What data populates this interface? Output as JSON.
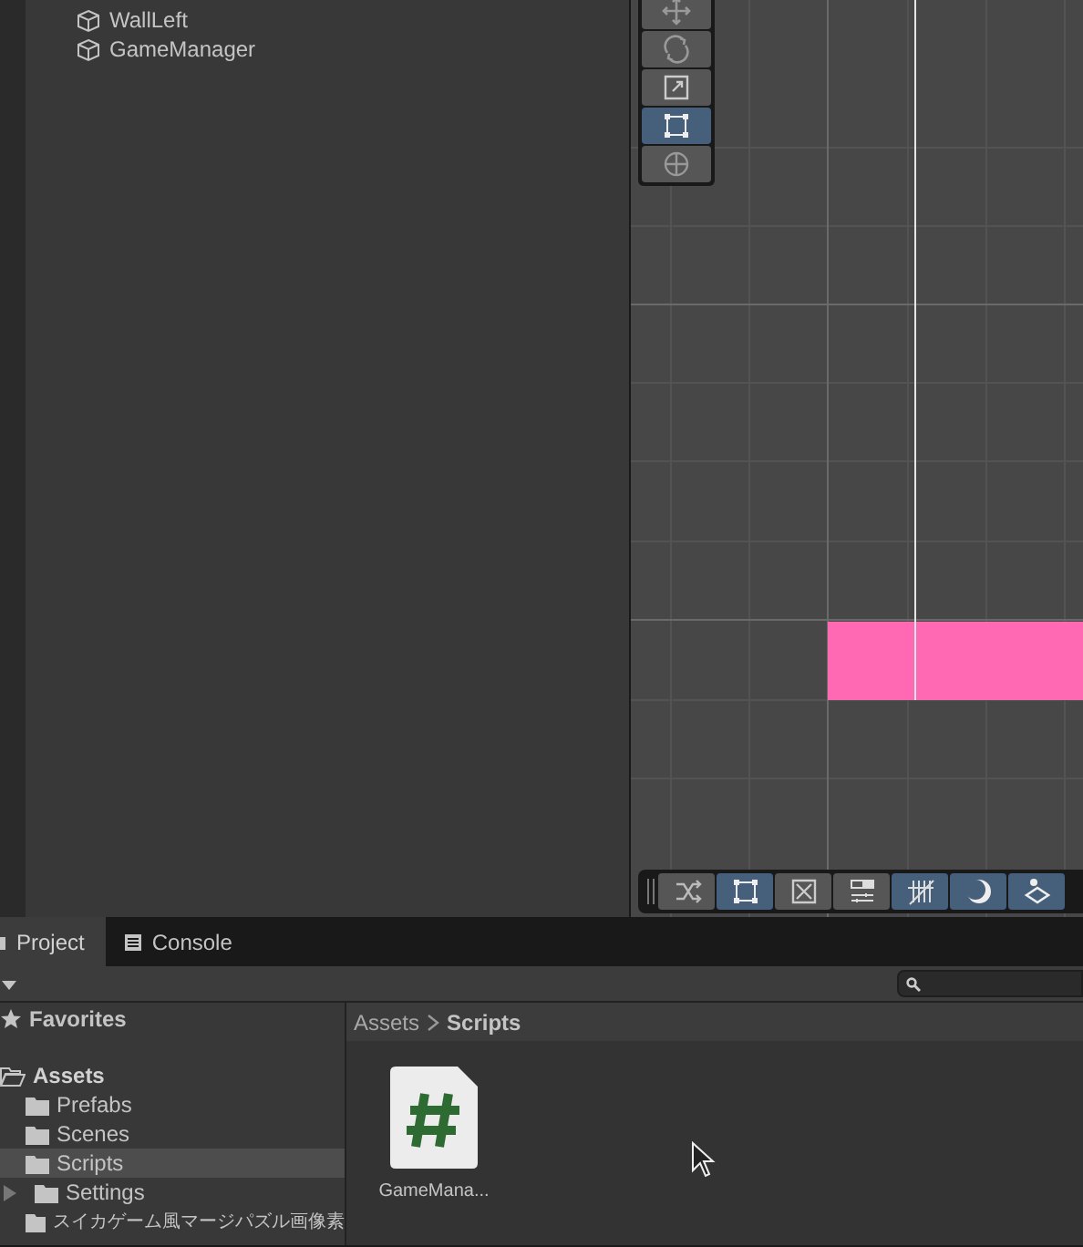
{
  "hierarchy": {
    "items": [
      {
        "label": "WallLeft"
      },
      {
        "label": "GameManager"
      }
    ]
  },
  "scene": {
    "tools": [
      {
        "kind": "move",
        "selected": false
      },
      {
        "kind": "rotate",
        "selected": false
      },
      {
        "kind": "scale",
        "selected": false
      },
      {
        "kind": "rect",
        "selected": true
      },
      {
        "kind": "transform",
        "selected": false
      }
    ],
    "overlay_toolbar": [
      {
        "kind": "shuffle",
        "selected": false
      },
      {
        "kind": "rect",
        "selected": true
      },
      {
        "kind": "cross",
        "selected": false
      },
      {
        "kind": "sliders",
        "selected": false
      },
      {
        "kind": "hatch",
        "selected": true
      },
      {
        "kind": "moon",
        "selected": true
      },
      {
        "kind": "layers",
        "selected": true
      }
    ]
  },
  "project": {
    "tabs": [
      {
        "label": "Project",
        "selected": true
      },
      {
        "label": "Console",
        "selected": false
      }
    ],
    "favorites": "Favorites",
    "tree": [
      {
        "label": "Assets",
        "expanded": true,
        "children": [
          {
            "label": "Prefabs",
            "selected": false
          },
          {
            "label": "Scenes",
            "selected": false
          },
          {
            "label": "Scripts",
            "selected": true
          },
          {
            "label": "Settings",
            "selected": false,
            "has_children": true
          },
          {
            "label": "スイカゲーム風マージパズル画像素",
            "selected": false
          }
        ]
      }
    ],
    "breadcrumb": [
      "Assets",
      "Scripts"
    ],
    "files": [
      {
        "label": "GameMana..."
      }
    ]
  }
}
